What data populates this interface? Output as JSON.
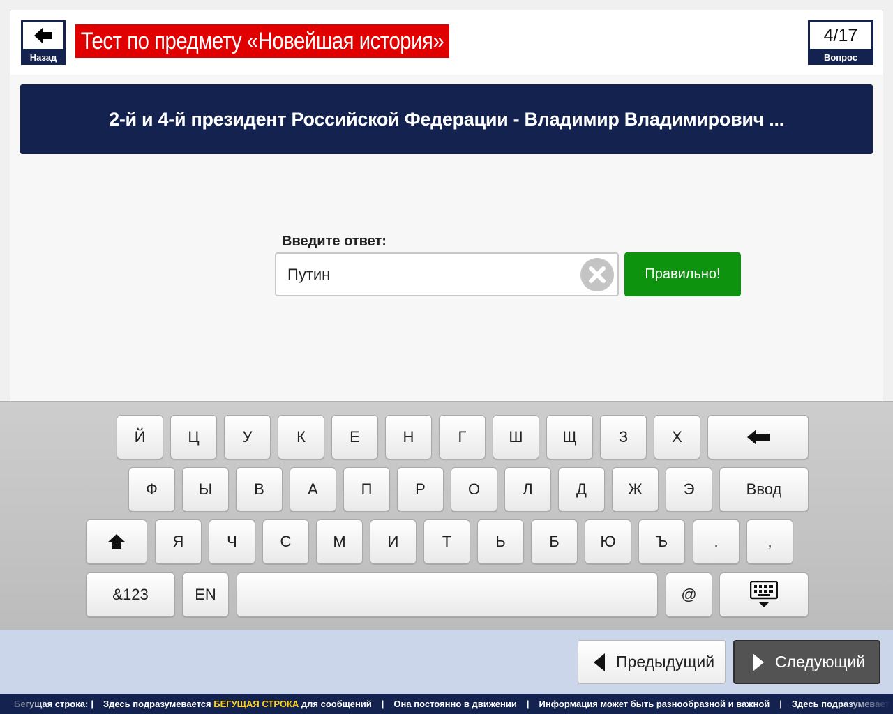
{
  "header": {
    "back_label": "Назад",
    "title": "Тест по предмету «Новейшая история»",
    "counter_value": "4/17",
    "counter_label": "Вопрос"
  },
  "question": {
    "text": "2-й и 4-й президент Российской Федерации - Владимир Владимирович ..."
  },
  "answer": {
    "label": "Введите ответ:",
    "value": "Путин",
    "check_button": "Правильно!",
    "check_color": "#0e930e"
  },
  "keyboard": {
    "row1": [
      "Й",
      "Ц",
      "У",
      "К",
      "Е",
      "Н",
      "Г",
      "Ш",
      "Щ",
      "З",
      "Х"
    ],
    "row2": [
      "Ф",
      "Ы",
      "В",
      "А",
      "П",
      "Р",
      "О",
      "Л",
      "Д",
      "Ж",
      "Э"
    ],
    "row3": [
      "Я",
      "Ч",
      "С",
      "М",
      "И",
      "Т",
      "Ь",
      "Б",
      "Ю",
      "Ъ",
      ".",
      ","
    ],
    "enter_label": "Ввод",
    "numeric_label": "&123",
    "lang_label": "EN",
    "at_label": "@",
    "icons": {
      "backspace": "backspace-arrow-icon",
      "shift": "shift-arrow-icon",
      "hide": "keyboard-hide-icon"
    }
  },
  "nav": {
    "prev_label": "Предыдущий",
    "next_label": "Следующий"
  },
  "ticker": {
    "item0": "Бегущая строка:",
    "item1_pre": "Здесь подразумевается",
    "item1_hl": "БЕГУЩАЯ СТРОКА",
    "item1_post": "для сообщений",
    "item2": "Она постоянно в движении",
    "item3": "Информация может быть разнообразной и важной",
    "item4": "Здесь подразумевается",
    "separator": "|"
  },
  "colors": {
    "navy": "#13224e",
    "title_red": "#e00000",
    "highlight_yellow": "#ffd21e"
  }
}
